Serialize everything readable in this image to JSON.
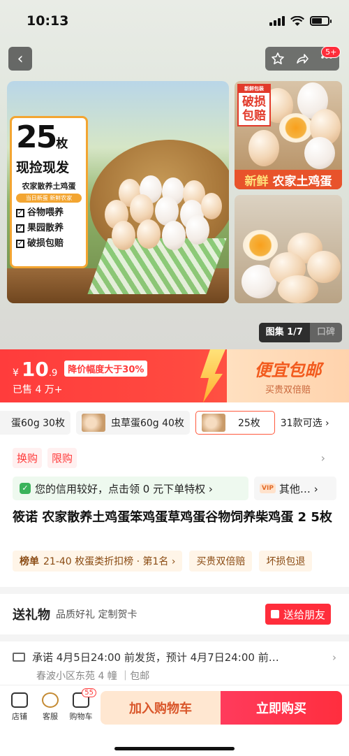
{
  "status": {
    "time": "10:13"
  },
  "nav": {
    "back": "‹",
    "badge": "5+"
  },
  "gallery": {
    "tag": {
      "count": "25",
      "unit": "枚",
      "slogan": "现捡现发",
      "name": "农家散养土鸡蛋",
      "pill": "当日新蛋 新鲜农家",
      "checks": [
        "谷物喂养",
        "果园散养",
        "破损包赔"
      ]
    },
    "side_tag": {
      "mini": "新鲜包装",
      "text": "破损包赔"
    },
    "side_banner": {
      "fresh": "新鲜",
      "text": "农家土鸡蛋"
    },
    "indicator_active": "图集 1/7",
    "indicator_inactive": "口碑"
  },
  "price": {
    "currency": "¥",
    "integer": "10",
    "decimal": ".9",
    "discount": "降价幅度大于30%",
    "sold": "已售 4 万+",
    "promo_title": "便宜包邮",
    "promo_sub": "买贵双倍赔"
  },
  "skus": [
    {
      "label": "蛋60g 30枚",
      "thumb": false,
      "selected": false
    },
    {
      "label": "虫草蛋60g 40枚",
      "thumb": true,
      "selected": false
    },
    {
      "label": "25枚",
      "thumb": true,
      "selected": true
    }
  ],
  "sku_more": "31款可选 ›",
  "tags": [
    "换购",
    "限购"
  ],
  "credit": {
    "text": "您的信用较好，点击领 0 元下单特权 ›",
    "vip_badge": "VIP",
    "vip_text": "其他… ›"
  },
  "title": "筱诺 农家散养土鸡蛋笨鸡蛋草鸡蛋谷物饲养柴鸡蛋 2 5枚",
  "ranks": [
    {
      "prefix": "榜单",
      "text": "21-40 枚蛋类折扣榜 · 第1名 ›"
    },
    {
      "prefix": "",
      "text": "买贵双倍赔"
    },
    {
      "prefix": "",
      "text": "坏损包退"
    }
  ],
  "gift": {
    "title": "送礼物",
    "sub": "品质好礼 定制贺卡",
    "button": "送给朋友"
  },
  "shipping": {
    "line1": "承诺 4月5日24:00 前发货，预计 4月7日24:00 前…",
    "line2": "春波小区东苑 4 幢 ｜包邮"
  },
  "bottom": {
    "shop": "店铺",
    "service": "客服",
    "cart": "购物车",
    "cart_count": "55",
    "add_cart": "加入购物车",
    "buy_now": "立即购买"
  }
}
